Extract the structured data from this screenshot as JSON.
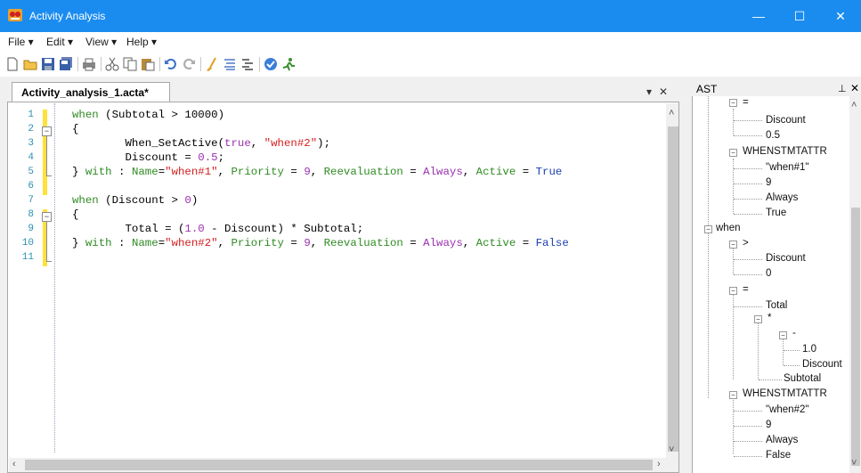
{
  "window": {
    "title": "Activity Analysis",
    "controls": {
      "minimize": "—",
      "maximize": "☐",
      "close": "✕"
    }
  },
  "menu": [
    {
      "label": "File ▾"
    },
    {
      "label": "Edit ▾"
    },
    {
      "label": "View ▾"
    },
    {
      "label": "Help ▾"
    }
  ],
  "toolbar": [
    "new-file-icon",
    "open-folder-icon",
    "save-icon",
    "save-all-icon",
    "print-icon",
    "cut-icon",
    "copy-icon",
    "paste-icon",
    "undo-icon",
    "redo-icon",
    "clean-icon",
    "align-icon",
    "outline-icon",
    "check-icon",
    "run-icon"
  ],
  "editor": {
    "tab_label": "Activity_analysis_1.acta*",
    "tab_dropdown": "▾",
    "tab_close": "✕",
    "line_numbers": [
      "1",
      "2",
      "3",
      "4",
      "5",
      "6",
      "7",
      "8",
      "9",
      "10",
      "11"
    ],
    "lines": {
      "l1": {
        "a": "when",
        "b": " (Subtotal > 10000)"
      },
      "l2": {
        "a": "{"
      },
      "l3": {
        "a": "        When_SetActive(",
        "b": "true",
        "c": ", ",
        "d": "\"when#2\"",
        "e": ");"
      },
      "l4": {
        "a": "        Discount = ",
        "b": "0.5",
        "c": ";"
      },
      "l5": {
        "a": "} ",
        "b": "with",
        "c": " : ",
        "d": "Name",
        "e": "=",
        "f": "\"when#1\"",
        "g": ", ",
        "h": "Priority",
        "i": " = ",
        "j": "9",
        "k": ", ",
        "l": "Reevaluation",
        "m": " = ",
        "n": "Always",
        "o": ", ",
        "p": "Active",
        "q": " = ",
        "r": "True"
      },
      "l7": {
        "a": "when",
        "b": " (Discount > ",
        "c": "0",
        "d": ")"
      },
      "l8": {
        "a": "{"
      },
      "l9": {
        "a": "        Total = (",
        "b": "1.0",
        "c": " - Discount) * Subtotal;"
      },
      "l10": {
        "a": "} ",
        "b": "with",
        "c": " : ",
        "d": "Name",
        "e": "=",
        "f": "\"when#2\"",
        "g": ", ",
        "h": "Priority",
        "i": " = ",
        "j": "9",
        "k": ", ",
        "l": "Reevaluation",
        "m": " = ",
        "n": "Always",
        "o": ", ",
        "p": "Active",
        "q": " = ",
        "r": "False"
      }
    }
  },
  "ast": {
    "title": "AST",
    "pin": "ᵖ",
    "close": "✕",
    "nodes": {
      "eq1": "=",
      "discount1": "Discount",
      "v05": "0.5",
      "attr1": "WHENSTMTATTR",
      "name1": "\"when#1\"",
      "prio1": "9",
      "reeval1": "Always",
      "active1": "True",
      "when2": "when",
      "gt": ">",
      "discount2": "Discount",
      "zero": "0",
      "eq2": "=",
      "total": "Total",
      "mul": "*",
      "minus": "-",
      "one": "1.0",
      "discount3": "Discount",
      "subtotal": "Subtotal",
      "attr2": "WHENSTMTATTR",
      "name2": "\"when#2\"",
      "prio2": "9",
      "reeval2": "Always",
      "active2": "False"
    }
  }
}
